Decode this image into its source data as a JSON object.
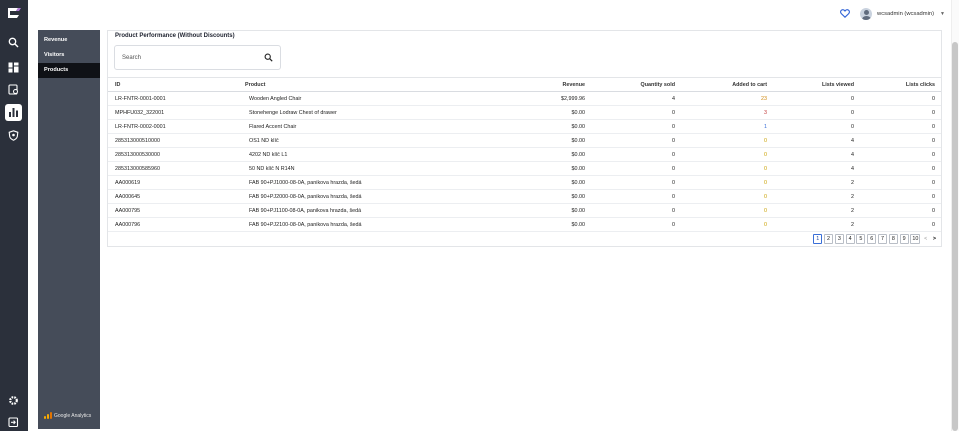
{
  "rail": {
    "icons": [
      "logo-icon",
      "search-icon",
      "dashboard-icon",
      "reports-icon",
      "analytics-icon",
      "shield-icon",
      "settings-icon",
      "logout-icon"
    ]
  },
  "subnav": {
    "items": [
      {
        "label": "Revenue",
        "active": false
      },
      {
        "label": "Visitors",
        "active": false
      },
      {
        "label": "Products",
        "active": true
      }
    ],
    "ga_label": "Google Analytics"
  },
  "header": {
    "user": "wcsadmin (wcsadmin)"
  },
  "card": {
    "title": "Product Performance (Without Discounts)",
    "search_placeholder": "Search"
  },
  "table": {
    "columns": {
      "id": "ID",
      "product": "Product",
      "revenue": "Revenue",
      "qty": "Quantity sold",
      "cart": "Added to cart",
      "views": "Lists viewed",
      "clicks": "Lists clicks"
    },
    "rows": [
      {
        "id": "LR-FNTR-0001-0001",
        "product": "Wooden Angled Chair",
        "revenue": "$2,999.96",
        "qty": "4",
        "cart": "23",
        "views": "0",
        "clicks": "0"
      },
      {
        "id": "MPHFU032_322001",
        "product": "Stonehenge Lodraw Chest of drawer",
        "revenue": "$0.00",
        "qty": "0",
        "cart": "3",
        "views": "0",
        "clicks": "0"
      },
      {
        "id": "LR-FNTR-0002-0001",
        "product": "Flared Accent Chair",
        "revenue": "$0.00",
        "qty": "0",
        "cart": "1",
        "views": "0",
        "clicks": "0"
      },
      {
        "id": "285313000510000",
        "product": "OS1 ND klíč",
        "revenue": "$0.00",
        "qty": "0",
        "cart": "0",
        "views": "4",
        "clicks": "0"
      },
      {
        "id": "285313000530000",
        "product": "4202 ND klíč L1",
        "revenue": "$0.00",
        "qty": "0",
        "cart": "0",
        "views": "4",
        "clicks": "0"
      },
      {
        "id": "285313000585960",
        "product": "50 ND klíč N R14N",
        "revenue": "$0.00",
        "qty": "0",
        "cart": "0",
        "views": "4",
        "clicks": "0"
      },
      {
        "id": "AA000619",
        "product": "FAB 90+PJ1000-08-0A, panikova hrazda, šedá",
        "revenue": "$0.00",
        "qty": "0",
        "cart": "0",
        "views": "2",
        "clicks": "0"
      },
      {
        "id": "AA000645",
        "product": "FAB 90+PJ2000-08-0A, panikova hrazda, šedá",
        "revenue": "$0.00",
        "qty": "0",
        "cart": "0",
        "views": "2",
        "clicks": "0"
      },
      {
        "id": "AA000795",
        "product": "FAB 90+PJ1100-08-0A, panikova hrazda, šedá",
        "revenue": "$0.00",
        "qty": "0",
        "cart": "0",
        "views": "2",
        "clicks": "0"
      },
      {
        "id": "AA000796",
        "product": "FAB 90+PJ2100-08-0A, panikova hrazda, šedá",
        "revenue": "$0.00",
        "qty": "0",
        "cart": "0",
        "views": "2",
        "clicks": "0"
      }
    ]
  },
  "pager": {
    "pages": [
      "1",
      "2",
      "3",
      "4",
      "5",
      "6",
      "7",
      "8",
      "9",
      "10"
    ],
    "current": "1",
    "prev": "<",
    "next": ">"
  },
  "colors": {
    "rail_bg": "#2b303b",
    "subnav_bg": "#454c59",
    "subnav_active": "#0f1116",
    "cart_high": "#d08a12",
    "cart_mid": "#c23b3b",
    "cart_low": "#3a6fd8",
    "cart_zero": "#c9a100",
    "heart": "#2f62d6"
  }
}
